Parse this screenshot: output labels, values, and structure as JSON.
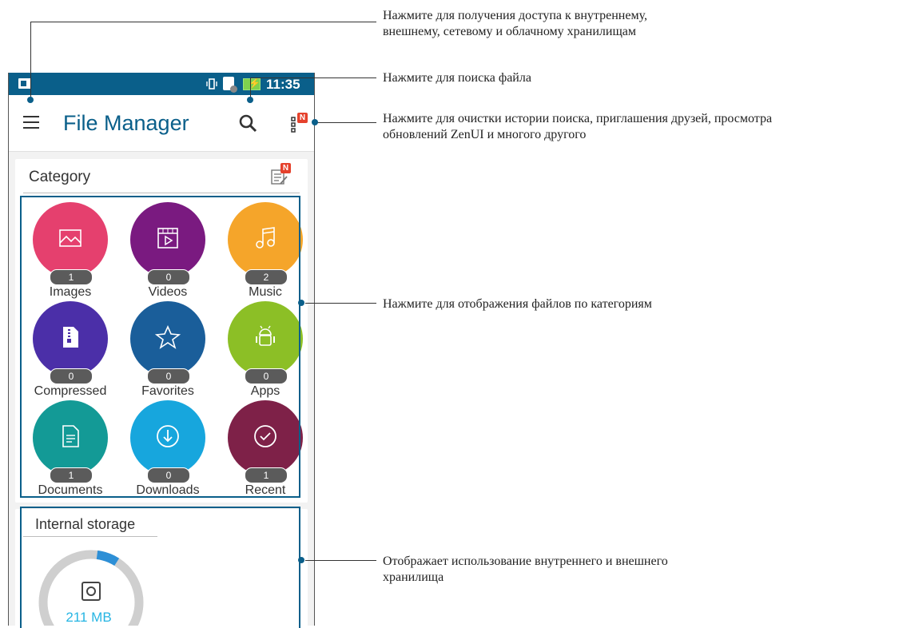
{
  "status_bar": {
    "time": "11:35"
  },
  "app_bar": {
    "title": "File Manager",
    "badge": "N"
  },
  "category": {
    "title": "Category",
    "badge": "N",
    "tiles": [
      {
        "label": "Images",
        "count": "1",
        "color": "#e5406e",
        "icon": "image-icon"
      },
      {
        "label": "Videos",
        "count": "0",
        "color": "#7a1a80",
        "icon": "video-icon"
      },
      {
        "label": "Music",
        "count": "2",
        "color": "#f5a52a",
        "icon": "music-icon"
      },
      {
        "label": "Compressed",
        "count": "0",
        "color": "#4b2fa8",
        "icon": "zip-icon"
      },
      {
        "label": "Favorites",
        "count": "0",
        "color": "#1a5e9a",
        "icon": "star-icon"
      },
      {
        "label": "Apps",
        "count": "0",
        "color": "#8cbf26",
        "icon": "android-icon"
      },
      {
        "label": "Documents",
        "count": "1",
        "color": "#139a96",
        "icon": "document-icon"
      },
      {
        "label": "Downloads",
        "count": "0",
        "color": "#17a6dd",
        "icon": "download-icon"
      },
      {
        "label": "Recent",
        "count": "1",
        "color": "#7e2148",
        "icon": "recent-check-icon"
      }
    ]
  },
  "storage": {
    "title": "Internal storage",
    "used": "211 MB",
    "used_fraction": 0.07
  },
  "callouts": {
    "storage_access": [
      "Нажмите для получения доступа к внутреннему,",
      "внешнему, сетевому и облачному хранилищам"
    ],
    "search": [
      "Нажмите для поиска файла"
    ],
    "menu": [
      "Нажмите для очистки истории поиска, приглашения друзей, просмотра",
      "обновлений ZenUI и многого другого"
    ],
    "categories": [
      "Нажмите для отображения файлов по категориям"
    ],
    "storage_usage": [
      "Отображает использование внутреннего и внешнего",
      "хранилища"
    ]
  },
  "colors": {
    "accent": "#0a5f8a",
    "storage_ring": "#cfcfcf",
    "storage_used": "#2d8fd6"
  }
}
